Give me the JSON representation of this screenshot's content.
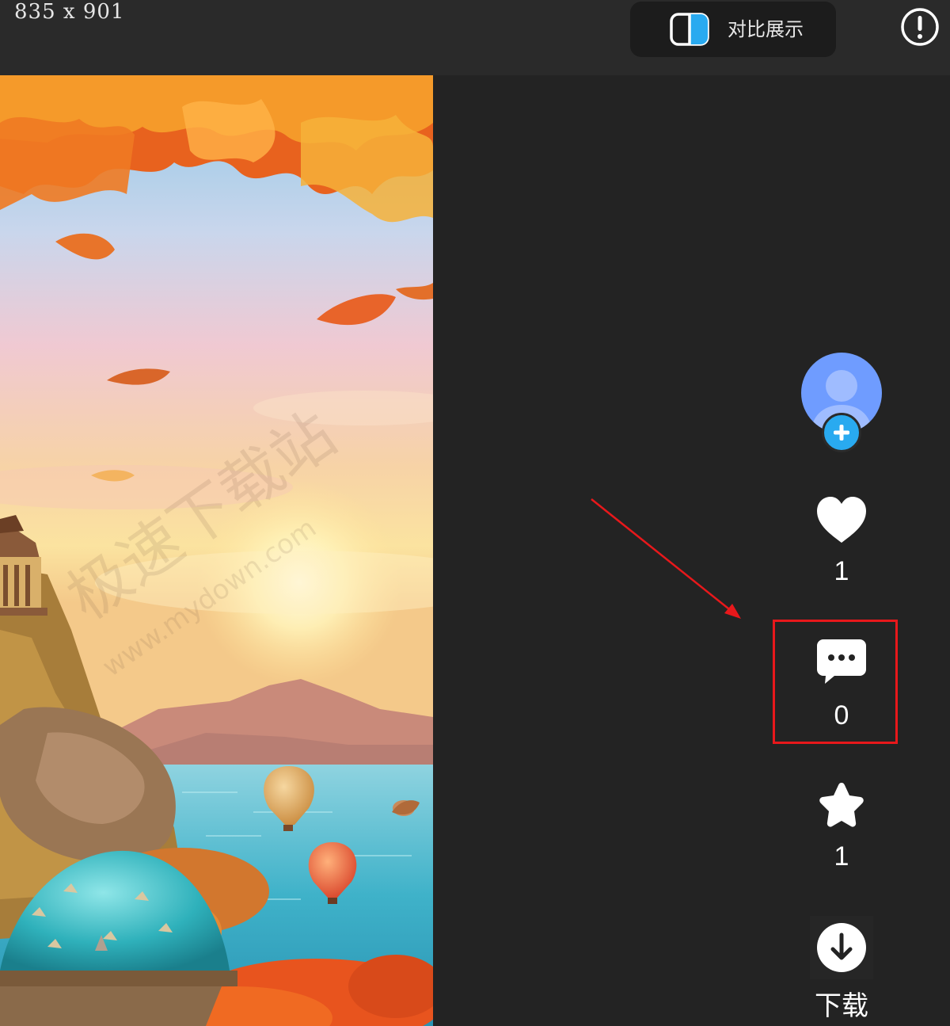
{
  "topbar": {
    "dimensions_text": "835 x 901",
    "compare_label": "对比展示",
    "compare_icon": "split-view-icon",
    "info_icon": "exclamation-circle-icon"
  },
  "image": {
    "description_icon": "generated-image"
  },
  "actions": {
    "avatar_icon": "user-avatar-icon",
    "follow_icon": "plus-icon",
    "like_icon": "heart-icon",
    "like_count": "1",
    "comment_icon": "chat-bubble-icon",
    "comment_count": "0",
    "favorite_icon": "star-icon",
    "favorite_count": "1",
    "download_icon": "download-circle-icon",
    "download_label": "下载"
  },
  "colors": {
    "background": "#232323",
    "topbar": "#2a2a2a",
    "accent_blue": "#29aaf0",
    "avatar_blue": "#6f9cff",
    "highlight_red": "#e8181b"
  }
}
